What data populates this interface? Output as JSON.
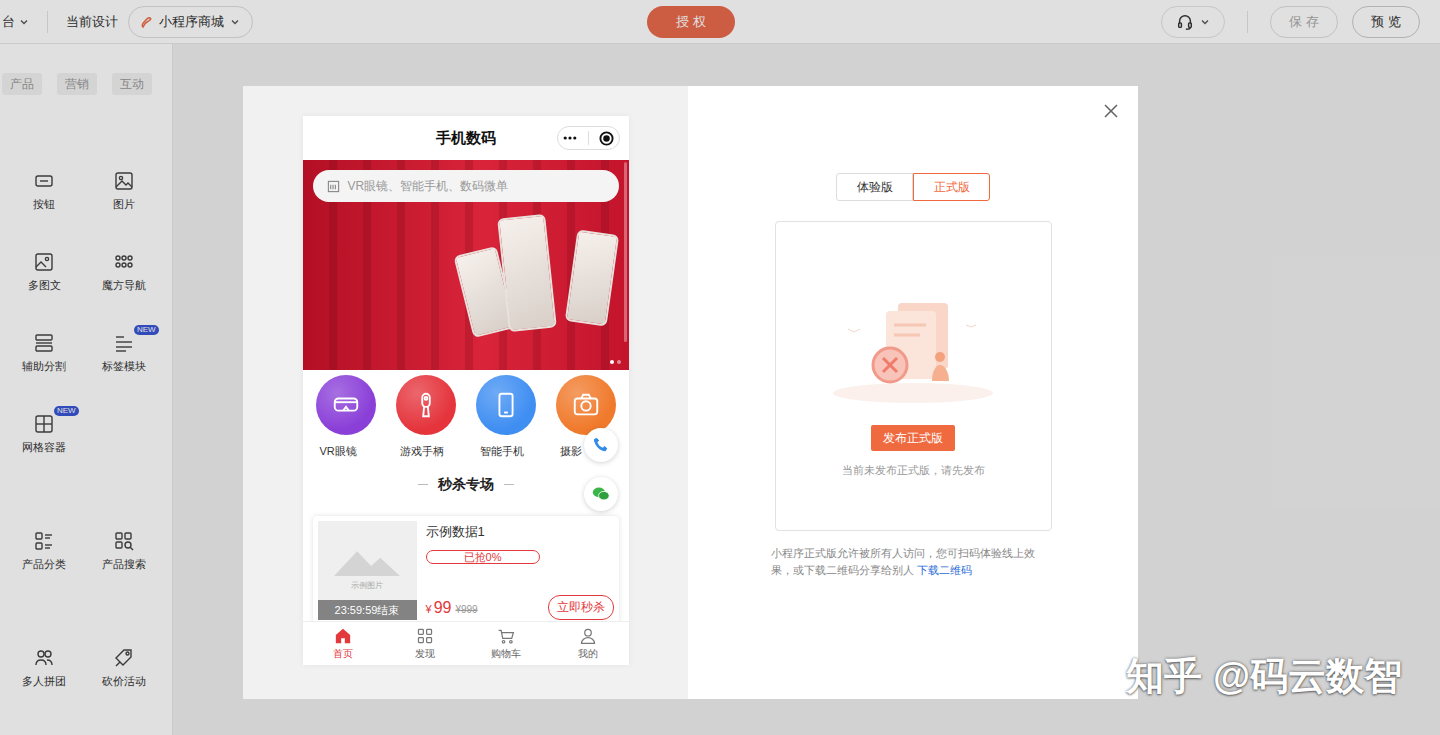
{
  "topbar": {
    "workspace": "台",
    "design_label": "当前设计",
    "design_name": "小程序商城",
    "authorize": "授 权",
    "save": {
      "label": "保 存",
      "disabled": true
    },
    "preview": "预 览"
  },
  "sidebar": {
    "tabs": [
      {
        "label": "产品",
        "selected": false
      },
      {
        "label": "营销",
        "selected": false
      },
      {
        "label": "互动",
        "selected": false
      }
    ],
    "groups": [
      {
        "items": [
          {
            "label": "按钮",
            "badge": ""
          },
          {
            "label": "图片",
            "badge": ""
          },
          {
            "label": "多图文",
            "badge": ""
          },
          {
            "label": "魔方导航",
            "badge": ""
          },
          {
            "label": "辅助分割",
            "badge": ""
          },
          {
            "label": "标签模块",
            "badge": "NEW"
          },
          {
            "label": "网格容器",
            "badge": "NEW"
          }
        ]
      },
      {
        "items": [
          {
            "label": "产品分类",
            "badge": ""
          },
          {
            "label": "产品搜索",
            "badge": ""
          }
        ]
      },
      {
        "items": [
          {
            "label": "多人拼团",
            "badge": ""
          },
          {
            "label": "砍价活动",
            "badge": ""
          }
        ]
      }
    ]
  },
  "preview": {
    "title": "手机数码",
    "search_placeholder": "VR眼镜、智能手机、数码微单",
    "banner_dots": [
      {
        "selected": true
      },
      {
        "selected": false
      }
    ],
    "nav": [
      {
        "label": "VR眼镜",
        "color": "#8a3fd8"
      },
      {
        "label": "游戏手柄",
        "color": "#e5343c"
      },
      {
        "label": "智能手机",
        "color": "#3f8ef2"
      },
      {
        "label": "摄影",
        "color": "#f07a2c"
      }
    ],
    "section_title": "秒杀专场",
    "deal": {
      "name": "示例数据1",
      "image_caption": "示例图片",
      "countdown": "23:59:59结束",
      "sold": "已抢0%",
      "level": 0,
      "currency": "¥",
      "price": "99",
      "original_price": "999",
      "button": "立即秒杀"
    },
    "tabbar": [
      {
        "label": "首页",
        "selected": true
      },
      {
        "label": "发现",
        "selected": false
      },
      {
        "label": "购物车",
        "selected": false
      },
      {
        "label": "我的",
        "selected": false
      }
    ]
  },
  "publish": {
    "tabs": [
      {
        "label": "体验版",
        "selected": false
      },
      {
        "label": "正式版",
        "selected": true
      }
    ],
    "button": "发布正式版",
    "empty_text": "当前未发布正式版，请先发布",
    "note": "小程序正式版允许被所有人访问，您可扫码体验线上效果，或下载二维码分享给别人",
    "note_link": "下载二维码"
  },
  "watermark": "知乎 @码云数智"
}
